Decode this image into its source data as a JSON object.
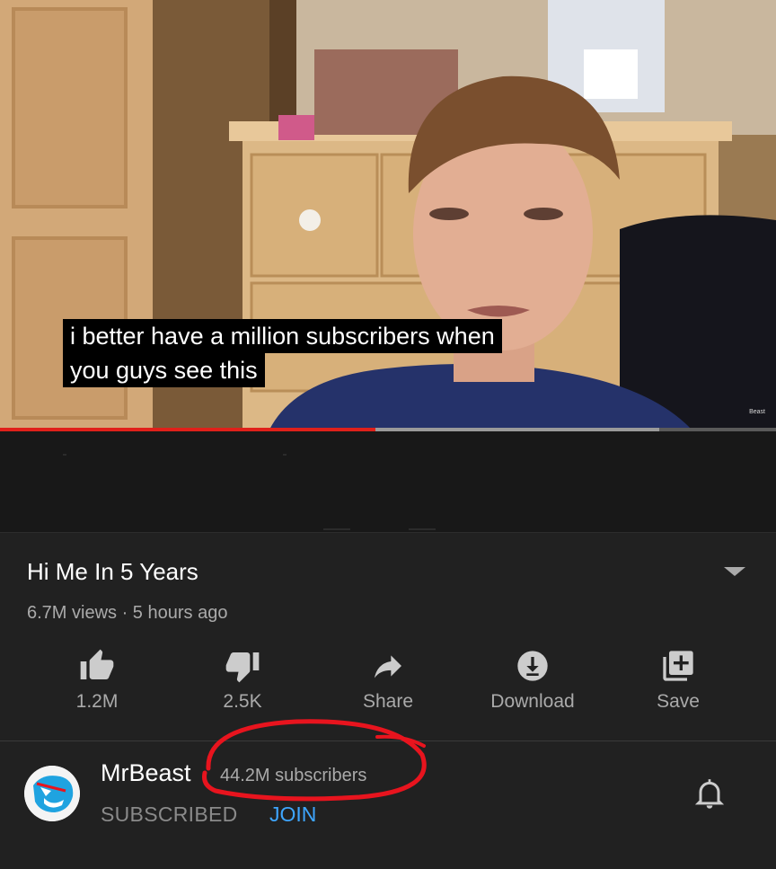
{
  "video": {
    "caption_lines": [
      "i better have a million subscribers when",
      "you guys see this"
    ],
    "watermark": "Beast",
    "progress_played_fraction": 0.484,
    "progress_buffered_fraction": 0.85,
    "colors": {
      "progress_played": "#e0201a",
      "progress_bg": "#5a5a5a"
    }
  },
  "info": {
    "title": "Hi Me In 5 Years",
    "meta": "6.7M views · 5 hours ago",
    "expand_icon": "chevron-down-icon"
  },
  "actions": [
    {
      "id": "like",
      "icon": "thumbs-up-icon",
      "label": "1.2M"
    },
    {
      "id": "dislike",
      "icon": "thumbs-down-icon",
      "label": "2.5K"
    },
    {
      "id": "share",
      "icon": "share-arrow-icon",
      "label": "Share"
    },
    {
      "id": "download",
      "icon": "download-icon",
      "label": "Download"
    },
    {
      "id": "save",
      "icon": "playlist-add-icon",
      "label": "Save"
    }
  ],
  "channel": {
    "name": "MrBeast",
    "subscribers": "44.2M subscribers",
    "subscribed_label": "SUBSCRIBED",
    "join_label": "JOIN",
    "bell_icon": "bell-icon",
    "colors": {
      "join": "#3ea6ff",
      "annotation": "#e8141e",
      "avatar_brand": "#1fa3e0"
    }
  }
}
